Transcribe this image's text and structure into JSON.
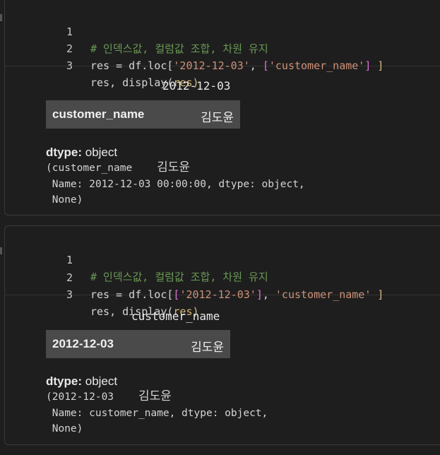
{
  "cells": [
    {
      "code": [
        {
          "num": "1",
          "comment": "# 인덱스값, 컬럼값 조합, 차원 유지"
        },
        {
          "num": "2",
          "pre": "res = df.loc[",
          "s1": "'2012-12-03'",
          "mid": ", ",
          "b1": "[",
          "s2": "'customer_name'",
          "b2": "]",
          "post": " ]"
        },
        {
          "num": "3",
          "pre": "res, display(",
          "arg": "res",
          "post": ")"
        }
      ],
      "output": {
        "header": "2012-12-03",
        "row_key": "customer_name",
        "row_value": "김도윤",
        "dtype_label": "dtype:",
        "dtype_value": "object",
        "repr_lines": [
          "(customer_name",
          "김도윤",
          " Name: 2012-12-03 00:00:00, dtype: object,",
          " None)"
        ]
      }
    },
    {
      "code": [
        {
          "num": "1",
          "comment": "# 인덱스값, 컬럼값 조합, 차원 유지"
        },
        {
          "num": "2",
          "pre": "res = df.loc[",
          "b1": "[",
          "s1": "'2012-12-03'",
          "b2": "]",
          "mid": ", ",
          "s2": "'customer_name'",
          "post": " ]"
        },
        {
          "num": "3",
          "pre": "res, display(",
          "arg": "res",
          "post": ")"
        }
      ],
      "output": {
        "header": "customer_name",
        "row_key": "2012-12-03",
        "row_value": "김도윤",
        "dtype_label": "dtype:",
        "dtype_value": "object",
        "repr_lines": [
          "(2012-12-03",
          "김도윤",
          " Name: customer_name, dtype: object,",
          " None)"
        ]
      }
    }
  ]
}
